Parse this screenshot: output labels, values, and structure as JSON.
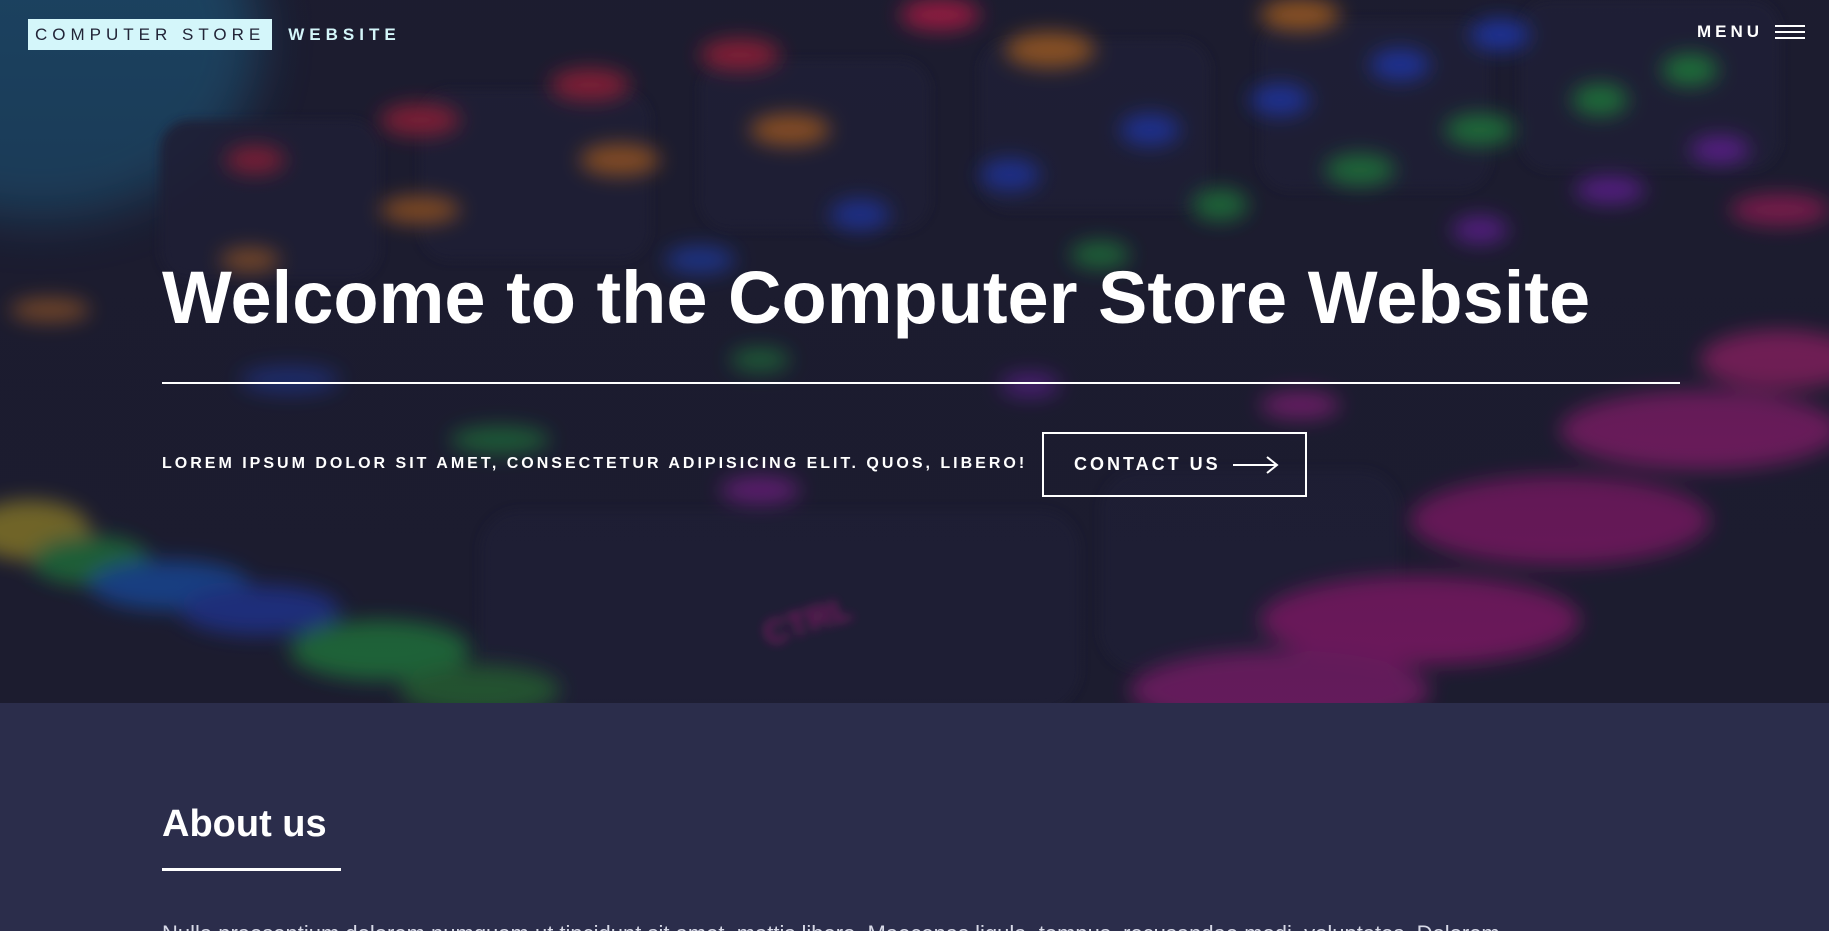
{
  "nav": {
    "brand_primary": "COMPUTER STORE",
    "brand_secondary": "WEBSITE",
    "menu_label": "MENU",
    "menu_icon": "hamburger-icon"
  },
  "hero": {
    "title": "Welcome to the Computer Store Website",
    "tagline": "LOREM IPSUM DOLOR SIT AMET, CONSECTETUR ADIPISICING ELIT. QUOS, LIBERO!",
    "cta_label": "CONTACT US",
    "cta_icon": "arrow-right-icon",
    "background": "blurred RGB backlit keyboard photo"
  },
  "about": {
    "title": "About us",
    "text": "Nulla praesentium dolorem numquam ut tincidunt sit amet, mattis libero. Maecenas ligula, tempus, recusandae modi, voluptates. Dolorem"
  },
  "colors": {
    "hero_bg": "#1a1a2e",
    "about_bg": "#2b2d4b",
    "brand_box_bg": "#d4f6fa",
    "text": "#ffffff"
  }
}
